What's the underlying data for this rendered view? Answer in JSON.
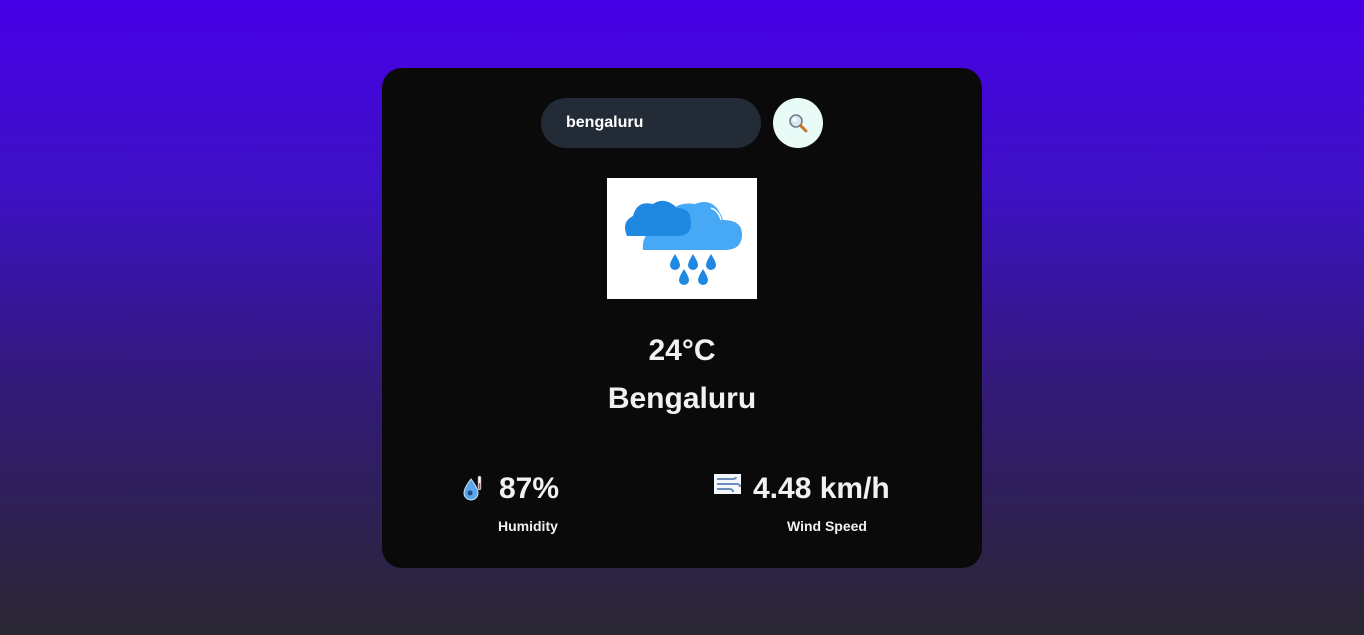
{
  "search": {
    "value": "bengaluru",
    "button_icon": "search-icon"
  },
  "weather": {
    "condition_icon": "rain-cloud-icon",
    "temperature": "24°C",
    "city": "Bengaluru"
  },
  "humidity": {
    "icon": "humidity-icon",
    "value": "87%",
    "label": "Humidity"
  },
  "wind": {
    "icon": "wind-icon",
    "value": "4.48 km/h",
    "label": "Wind Speed"
  },
  "colors": {
    "card_background": "#0a0a0a",
    "input_background": "#222b36",
    "button_background": "#e9fbf6",
    "gradient_top": "#4700e8",
    "gradient_bottom": "#2a2732"
  }
}
